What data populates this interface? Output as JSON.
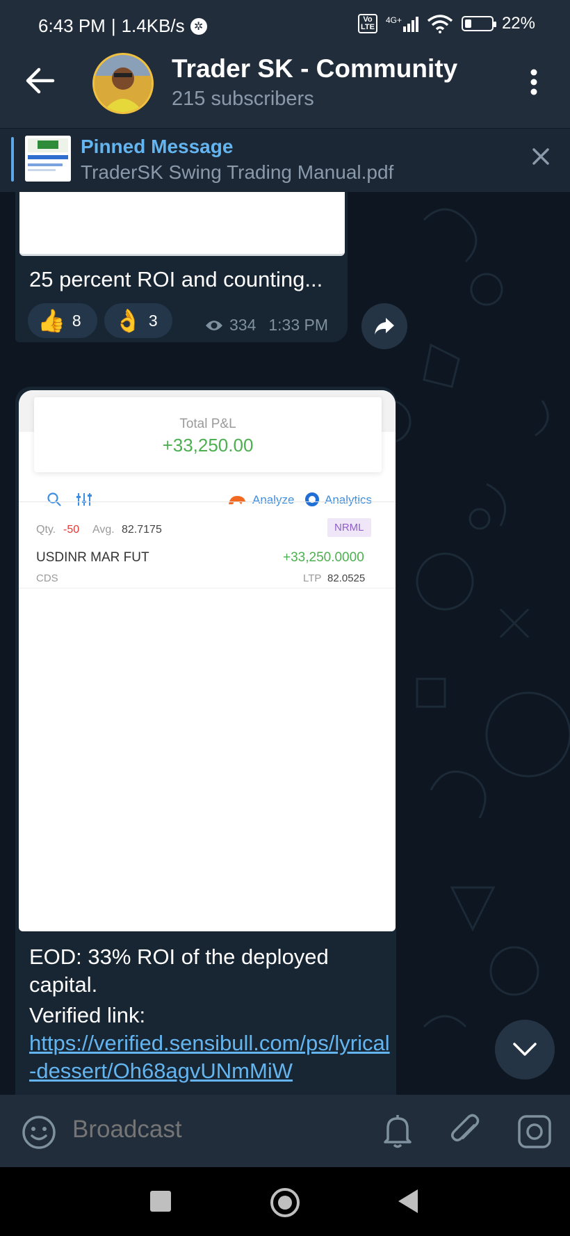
{
  "status_bar": {
    "time": "6:43 PM",
    "speed": "1.4KB/s",
    "network": "4G+",
    "volte": "Vo LTE",
    "battery": "22%",
    "battery_level": 0.22
  },
  "header": {
    "title": "Trader SK - Community",
    "subscribers": "215 subscribers"
  },
  "pinned": {
    "label": "Pinned Message",
    "file": "TraderSK Swing Trading Manual.pdf"
  },
  "messages": [
    {
      "text": "25 percent ROI and counting...",
      "reactions": [
        {
          "emoji": "👍",
          "count": "8"
        },
        {
          "emoji": "👌",
          "count": "3"
        }
      ],
      "views": "334",
      "time": "1:33 PM"
    },
    {
      "screenshot": {
        "total_label": "Total P&L",
        "total_value": "+33,250.00",
        "analyze": "Analyze",
        "analytics": "Analytics",
        "qty_label": "Qty.",
        "qty_value": "-50",
        "avg_label": "Avg.",
        "avg_value": "82.7175",
        "product": "NRML",
        "instrument": "USDINR MAR FUT",
        "pnl": "+33,250.0000",
        "exchange": "CDS",
        "ltp_label": "LTP",
        "ltp_value": "82.0525"
      },
      "text1": "EOD: 33% ROI of the deployed capital.",
      "text2": "Verified link:",
      "link": "https://verified.sensibull.com/ps/lyrical-dessert/Oh68agvUNmMiW"
    }
  ],
  "input": {
    "placeholder": "Broadcast"
  },
  "colors": {
    "accent": "#64b5ef",
    "header_bg": "#212d3b",
    "chat_bg": "#0e1621",
    "bubble_bg": "#182533",
    "profit_green": "#4caf50"
  }
}
